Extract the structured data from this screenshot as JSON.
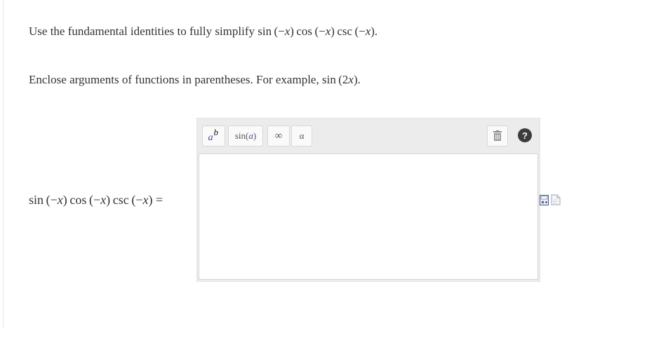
{
  "question": {
    "prefix": "Use the fundamental identities to fully simplify ",
    "expression": {
      "sin": "sin",
      "cos": "cos",
      "csc": "csc",
      "arg": "(−x)"
    },
    "suffix": "."
  },
  "hint": {
    "prefix": "Enclose arguments of functions in parentheses. For example, ",
    "example_fn": "sin",
    "example_arg_open": "(2",
    "example_var": "x",
    "example_arg_close": ")",
    "suffix": "."
  },
  "answer_label": {
    "sin": "sin",
    "cos": "cos",
    "csc": "csc",
    "open": "(−",
    "var": "x",
    "close": ")",
    "equals": "="
  },
  "toolbar": {
    "power_base": "a",
    "power_exp": "b",
    "trig_fn": "sin",
    "trig_open": " (",
    "trig_arg": "a",
    "trig_close": ")",
    "infinity": "∞",
    "alpha": "α",
    "help": "?"
  },
  "icons": {
    "power": "power-icon",
    "trash": "trash-icon",
    "help": "help-icon",
    "math_palette": "math-palette-icon",
    "document": "document-icon"
  },
  "colors": {
    "toolbar_bg": "#ececec",
    "accent_blue": "#3a4aa0",
    "help_bg": "#3c3c3c"
  },
  "answer_input": {
    "value": ""
  }
}
